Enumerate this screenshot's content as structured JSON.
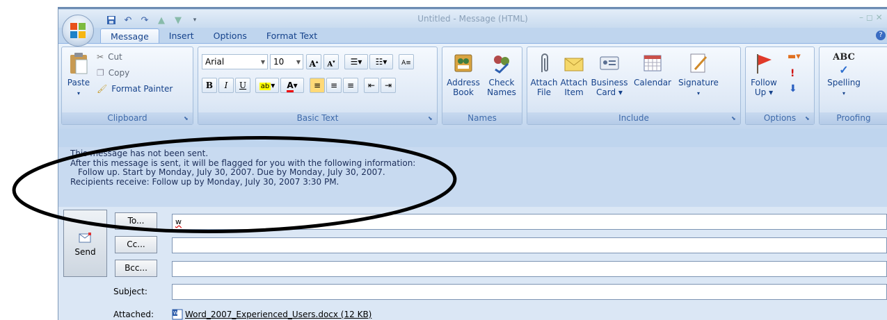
{
  "window": {
    "title": "Untitled - Message (HTML)",
    "controls": "– ◻ ✕"
  },
  "tabs": [
    {
      "label": "Message"
    },
    {
      "label": "Insert"
    },
    {
      "label": "Options"
    },
    {
      "label": "Format Text"
    }
  ],
  "clipboard": {
    "paste": "Paste",
    "cut": "Cut",
    "copy": "Copy",
    "format_painter": "Format Painter",
    "group": "Clipboard"
  },
  "basic_text": {
    "font": "Arial",
    "size": "10",
    "bold": "B",
    "italic": "I",
    "underline": "U",
    "grow": "A",
    "shrink": "A",
    "group": "Basic Text"
  },
  "names": {
    "address_book_1": "Address",
    "address_book_2": "Book",
    "check_names_1": "Check",
    "check_names_2": "Names",
    "group": "Names"
  },
  "include": {
    "attach_file_1": "Attach",
    "attach_file_2": "File",
    "attach_item_1": "Attach",
    "attach_item_2": "Item",
    "business_card_1": "Business",
    "business_card_2": "Card ▾",
    "calendar": "Calendar",
    "signature": "Signature",
    "group": "Include"
  },
  "options": {
    "follow_up_1": "Follow",
    "follow_up_2": "Up ▾",
    "group": "Options"
  },
  "proofing": {
    "spelling": "Spelling",
    "abc": "ABC",
    "group": "Proofing"
  },
  "info": {
    "line1": "This message has not been sent.",
    "line2": "After this message is sent, it will be flagged for you with the following information:",
    "line3": "Follow up.  Start by Monday, July 30, 2007.  Due by Monday, July 30, 2007.",
    "line4": "Recipients receive: Follow up by Monday, July 30, 2007 3:30 PM."
  },
  "header": {
    "send": "Send",
    "to_button": "To...",
    "cc_button": "Cc...",
    "bcc_button": "Bcc...",
    "to_value": "w",
    "subject_label": "Subject:",
    "attached_label": "Attached:",
    "attachment": "Word_2007_Experienced_Users.docx (12 KB)"
  }
}
